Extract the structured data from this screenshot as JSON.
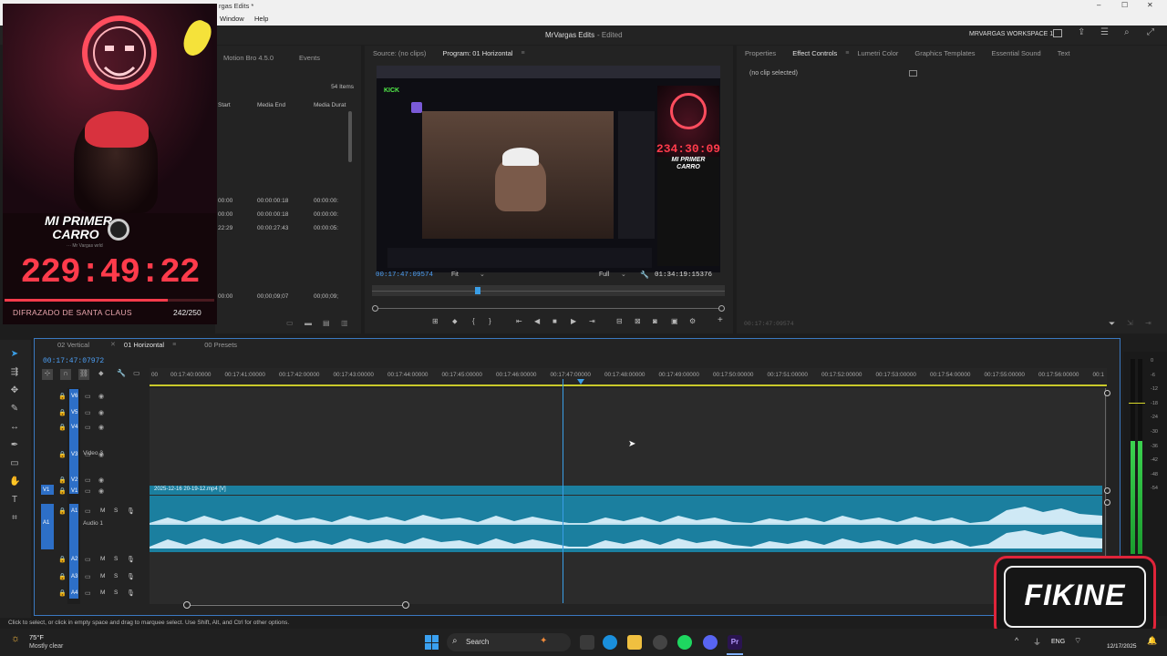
{
  "window": {
    "title_fragment": "rgas Edits *",
    "controls": [
      "–",
      "☐",
      "✕"
    ]
  },
  "menu": {
    "items": [
      "Window",
      "Help"
    ]
  },
  "app": {
    "project_title": "MrVargas Edits",
    "edited_state": "- Edited",
    "workspace": "MRVARGAS WORKSPACE 1"
  },
  "webcam": {
    "sign_line1": "MI PRIMER",
    "sign_line2": "CARRO",
    "sign_small": "··· Mr Vargas wrld",
    "timer": "229:49:22",
    "subathon_label": "DIFRAZADO DE SANTA CLAUS",
    "subathon_count": "242/250",
    "progress": 0.78
  },
  "project_panel": {
    "tabs": [
      "Motion Bro 4.5.0",
      "Events"
    ],
    "item_count": "54 Items",
    "columns": [
      "Start",
      "Media End",
      "Media Durat"
    ],
    "rows": [
      [
        "00:00",
        "00:00:00:18",
        "00:00:00:"
      ],
      [
        "00:00",
        "00:00:00:18",
        "00:00:00:"
      ],
      [
        "22:29",
        "00:00:27:43",
        "00:00:05:"
      ],
      [
        "00:00",
        "00;00;09;07",
        "00;00;09;"
      ]
    ]
  },
  "program_monitor": {
    "tabs": [
      "Source: (no clips)",
      "Program: 01 Horizontal"
    ],
    "current_time": "00:17:47:09574",
    "fit": "Fit",
    "quality": "Full",
    "duration": "01:34:19:15376",
    "playhead": 0.3,
    "preview": {
      "timer": "234:30:09",
      "sign_line1": "MI PRIMER",
      "sign_line2": "CARRO",
      "site": "KICK"
    }
  },
  "effect_panel": {
    "tabs": [
      "Properties",
      "Effect Controls",
      "Lumetri Color",
      "Graphics Templates",
      "Essential Sound",
      "Text"
    ],
    "active": "Effect Controls",
    "empty": "(no clip selected)",
    "time": "00:17:47:09574"
  },
  "timeline": {
    "tabs": [
      "02 Vertical",
      "01 Horizontal",
      "00 Presets"
    ],
    "active": "01 Horizontal",
    "timecode": "00:17:47:07972",
    "ruler": [
      "00",
      "00:17:40:00000",
      "00:17:41:00000",
      "00:17:42:00000",
      "00:17:43:00000",
      "00:17:44:00000",
      "00:17:45:00000",
      "00:17:46:00000",
      "00:17:47:00000",
      "00:17:48:00000",
      "00:17:49:00000",
      "00:17:50:00000",
      "00:17:51:00000",
      "00:17:52:00000",
      "00:17:53:00000",
      "00:17:54:00000",
      "00:17:55:00000",
      "00:17:56:00000",
      "00:1"
    ],
    "video_tracks": [
      "V6",
      "V5",
      "V4",
      "V3",
      "V2",
      "V1"
    ],
    "video3_name": "Video 3",
    "audio_tracks": [
      "A1",
      "A2",
      "A3",
      "A4"
    ],
    "audio1_name": "Audio 1",
    "clip_name": "2025-12-16 20-19-12.mp4 [V]",
    "m_label": "M",
    "s_label": "S"
  },
  "meter": {
    "labels": [
      "0",
      "-6",
      "-12",
      "-18",
      "-24",
      "-30",
      "-36",
      "-42",
      "-48",
      "-54"
    ],
    "level": 0.58
  },
  "status": {
    "hint": "Click to select, or click in empty space and drag to marquee select. Use Shift, Alt, and Ctrl for other options."
  },
  "overlay_logo": {
    "text": "FIKINE"
  },
  "taskbar": {
    "weather_temp": "75°F",
    "weather_desc": "Mostly clear",
    "search": "Search",
    "lang": "ENG",
    "date": "12/17/2025",
    "premiere": "Pr"
  },
  "colors": {
    "accent": "#2d8ceb",
    "clip": "#1b7f9f",
    "timer_red": "#ff3b4b",
    "playhead": "#3a9ee6"
  }
}
